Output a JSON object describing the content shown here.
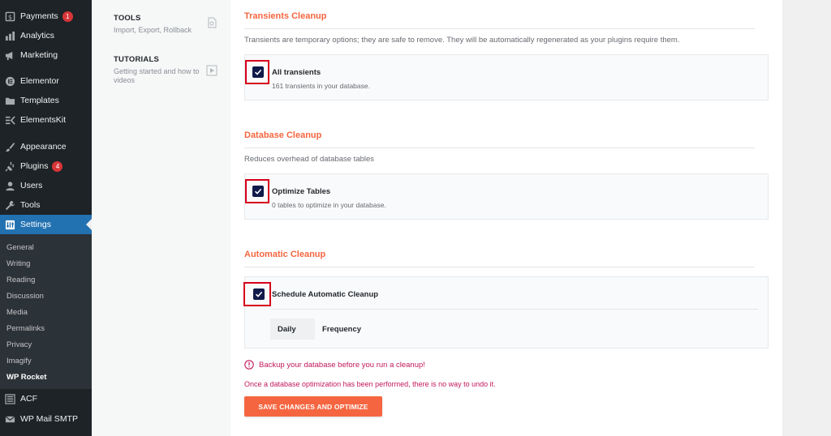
{
  "sidebar": {
    "items": [
      {
        "label": "Payments",
        "badge": "1",
        "icon": "payments-icon"
      },
      {
        "label": "Analytics",
        "icon": "analytics-icon"
      },
      {
        "label": "Marketing",
        "icon": "megaphone-icon"
      },
      {
        "label": "Elementor",
        "icon": "elementor-icon"
      },
      {
        "label": "Templates",
        "icon": "folder-icon"
      },
      {
        "label": "ElementsKit",
        "icon": "elementskit-icon"
      },
      {
        "label": "Appearance",
        "icon": "paintbrush-icon"
      },
      {
        "label": "Plugins",
        "badge": "4",
        "icon": "plug-icon"
      },
      {
        "label": "Users",
        "icon": "user-icon"
      },
      {
        "label": "Tools",
        "icon": "wrench-icon"
      },
      {
        "label": "Settings",
        "icon": "settings-icon",
        "active": true
      },
      {
        "label": "ACF",
        "icon": "acf-icon"
      },
      {
        "label": "WP Mail SMTP",
        "icon": "mail-icon"
      }
    ],
    "submenu": [
      "General",
      "Writing",
      "Reading",
      "Discussion",
      "Media",
      "Permalinks",
      "Privacy",
      "Imagify",
      "WP Rocket"
    ],
    "current_submenu": "WP Rocket"
  },
  "rocket_nav": [
    {
      "title": "TOOLS",
      "desc": "Import, Export, Rollback",
      "icon": "tools-icon"
    },
    {
      "title": "TUTORIALS",
      "desc": "Getting started and how to videos",
      "icon": "video-icon"
    }
  ],
  "transients": {
    "title": "Transients Cleanup",
    "desc": "Transients are temporary options; they are safe to remove. They will be automatically regenerated as your plugins require them.",
    "option_label": "All transients",
    "option_sub": "161 transients in your database.",
    "checked": true
  },
  "database": {
    "title": "Database Cleanup",
    "desc": "Reduces overhead of database tables",
    "option_label": "Optimize Tables",
    "option_sub": "0 tables to optimize in your database.",
    "checked": true
  },
  "automatic": {
    "title": "Automatic Cleanup",
    "option_label": "Schedule Automatic Cleanup",
    "checked": true,
    "frequency_value": "Daily",
    "frequency_label": "Frequency"
  },
  "warning": "Backup your database before you run a cleanup!",
  "note": "Once a database optimization has been performed, there is no way to undo it.",
  "save_button": "SAVE CHANGES AND OPTIMIZE",
  "colors": {
    "accent": "#f56640",
    "warning": "#c2185b",
    "highlight": "#d6001c",
    "wp_sidebar": "#1d2327",
    "wp_active": "#2271b1"
  }
}
